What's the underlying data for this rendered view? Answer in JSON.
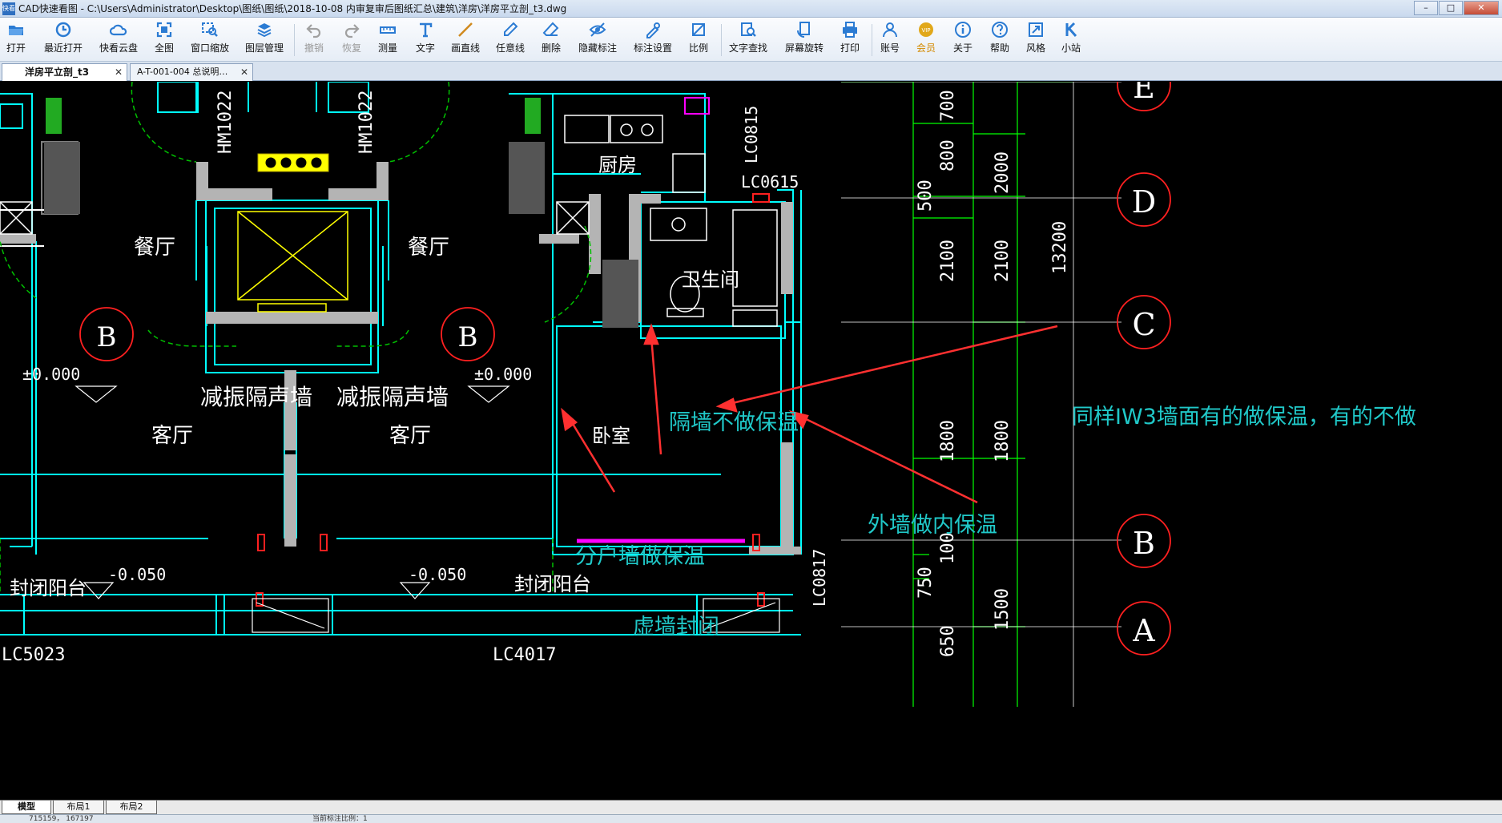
{
  "window": {
    "app_icon_text": "快看",
    "title": "CAD快速看图 - C:\\Users\\Administrator\\Desktop\\图纸\\图纸\\2018-10-08 内审复审后图纸汇总\\建筑\\洋房\\洋房平立剖_t3.dwg",
    "controls": [
      "–",
      "□",
      "✕"
    ]
  },
  "toolbar": {
    "buttons": [
      {
        "label": "打开",
        "icon": "open-folder-icon",
        "color": "#2b7bd3"
      },
      {
        "label": "最近打开",
        "icon": "recent-clock-icon",
        "color": "#2b7bd3"
      },
      {
        "label": "快看云盘",
        "icon": "cloud-icon",
        "color": "#2b7bd3"
      },
      {
        "label": "全图",
        "icon": "fit-all-icon",
        "color": "#2b7bd3"
      },
      {
        "label": "窗口缩放",
        "icon": "window-zoom-icon",
        "color": "#2b7bd3"
      },
      {
        "label": "图层管理",
        "icon": "layers-icon",
        "color": "#2b7bd3"
      },
      {
        "label": "撤销",
        "icon": "undo-icon",
        "color": "#a0a0a0"
      },
      {
        "label": "恢复",
        "icon": "redo-icon",
        "color": "#a0a0a0"
      },
      {
        "label": "测量",
        "icon": "measure-icon",
        "color": "#2b7bd3"
      },
      {
        "label": "文字",
        "icon": "text-icon",
        "color": "#2b7bd3"
      },
      {
        "label": "画直线",
        "icon": "line-icon",
        "color": "#d08a1e"
      },
      {
        "label": "任意线",
        "icon": "freehand-icon",
        "color": "#2b7bd3"
      },
      {
        "label": "删除",
        "icon": "eraser-icon",
        "color": "#2b7bd3"
      },
      {
        "label": "隐藏标注",
        "icon": "eye-hide-icon",
        "color": "#2b7bd3"
      },
      {
        "label": "标注设置",
        "icon": "annotation-settings-icon",
        "color": "#2b7bd3"
      },
      {
        "label": "比例",
        "icon": "scale-icon",
        "color": "#2b7bd3"
      },
      {
        "label": "文字查找",
        "icon": "find-text-icon",
        "color": "#2b7bd3"
      },
      {
        "label": "屏幕旋转",
        "icon": "rotate-screen-icon",
        "color": "#2b7bd3"
      },
      {
        "label": "打印",
        "icon": "printer-icon",
        "color": "#2b7bd3"
      },
      {
        "label": "账号",
        "icon": "user-icon",
        "color": "#2b7bd3"
      },
      {
        "label": "会员",
        "icon": "vip-icon",
        "color": "#e1a81a"
      },
      {
        "label": "关于",
        "icon": "info-icon",
        "color": "#2b7bd3"
      },
      {
        "label": "帮助",
        "icon": "help-icon",
        "color": "#2b7bd3"
      },
      {
        "label": "风格",
        "icon": "style-icon",
        "color": "#2b7bd3"
      },
      {
        "label": "小站",
        "icon": "k-station-icon",
        "color": "#2b7bd3"
      }
    ]
  },
  "tabs": [
    {
      "label": "洋房平立剖_t3",
      "active": true
    },
    {
      "label": "A-T-001-004 总说明…",
      "active": false
    }
  ],
  "drawing": {
    "room_labels": [
      "餐厅",
      "餐厅",
      "客厅",
      "客厅",
      "厨房",
      "卫生间",
      "卧室",
      "封闭阳台",
      "封闭阳台"
    ],
    "wall_labels": [
      "减振隔声墙",
      "减振隔声墙"
    ],
    "door_window_labels": [
      "HM1022",
      "HM1022",
      "LC0815",
      "LC0615",
      "LC0817",
      "LC5023",
      "LC4017"
    ],
    "elevations": [
      "±0.000",
      "±0.000",
      "-0.050",
      "-0.050"
    ],
    "axis_labels": [
      "E",
      "D",
      "C",
      "B",
      "A",
      "B",
      "B"
    ],
    "dimensions": [
      "700",
      "800",
      "500",
      "2100",
      "1800",
      "100",
      "750",
      "650",
      "2000",
      "2100",
      "1800",
      "1500",
      "13200"
    ],
    "annotations": [
      "隔墙不做保温",
      "同样IW3墙面有的做保温，有的不做",
      "外墙做内保温",
      "分户墙做保温",
      "虚墙封闭"
    ],
    "colors": {
      "wall": "#00ffff",
      "wall_fill": "#b4b4b4",
      "dimension": "#00ff00",
      "axis_circle": "#ff2020",
      "annotation_text": "#20c8c8",
      "arrow": "#ff3030",
      "elevator_fill": "#ffff00",
      "virtual_wall": "#ff00ff"
    }
  },
  "layout_tabs": [
    "模型",
    "布局1",
    "布局2"
  ],
  "status": {
    "coords": "715159，   167197",
    "scale": "当前标注比例：1"
  }
}
